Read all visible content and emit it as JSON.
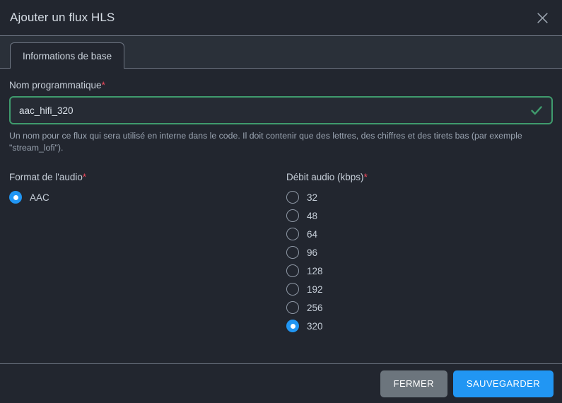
{
  "dialog": {
    "title": "Ajouter un flux HLS",
    "close_icon": "close-icon"
  },
  "tabs": [
    {
      "label": "Informations de base",
      "active": true
    }
  ],
  "form": {
    "program_name": {
      "label": "Nom programmatique",
      "required_marker": "*",
      "value": "aac_hifi_320",
      "placeholder": "",
      "valid_icon": "check-icon",
      "help": "Un nom pour ce flux qui sera utilisé en interne dans le code. Il doit contenir que des lettres, des chiffres et des tirets bas (par exemple \"stream_lofi\")."
    },
    "audio_format": {
      "label": "Format de l'audio",
      "required_marker": "*",
      "options": [
        {
          "label": "AAC",
          "selected": true
        }
      ]
    },
    "audio_bitrate": {
      "label": "Débit audio (kbps)",
      "required_marker": "*",
      "options": [
        {
          "label": "32",
          "selected": false
        },
        {
          "label": "48",
          "selected": false
        },
        {
          "label": "64",
          "selected": false
        },
        {
          "label": "96",
          "selected": false
        },
        {
          "label": "128",
          "selected": false
        },
        {
          "label": "192",
          "selected": false
        },
        {
          "label": "256",
          "selected": false
        },
        {
          "label": "320",
          "selected": true
        }
      ]
    }
  },
  "footer": {
    "close_label": "FERMER",
    "save_label": "SAUVEGARDER"
  },
  "colors": {
    "accent_blue": "#2196f3",
    "valid_green": "#3f9b6d",
    "required_red": "#f0485b",
    "secondary_gray": "#6c757d",
    "dialog_bg": "#22262f",
    "tabstrip_bg": "#2a3039"
  }
}
